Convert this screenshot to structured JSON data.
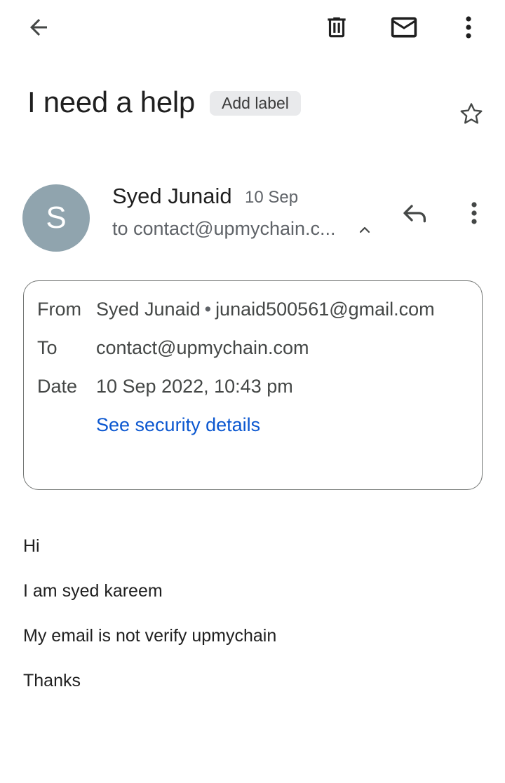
{
  "toolbar": {
    "back_icon": "arrow-back-icon",
    "delete_icon": "trash-icon",
    "mark_unread_icon": "mail-icon",
    "more_icon": "more-vert-icon"
  },
  "subject": {
    "title": "I need a help",
    "label_chip": "Add label",
    "star_icon": "star-outline-icon"
  },
  "message": {
    "avatar_initial": "S",
    "avatar_color": "#90a4ae",
    "sender_name": "Syed Junaid",
    "date": "10 Sep",
    "recipient_summary": "to contact@upmychain.c...",
    "collapse_icon": "chevron-up-icon",
    "reply_icon": "reply-icon",
    "more_icon": "more-vert-icon"
  },
  "details": {
    "from_label": "From",
    "from_name": "Syed Junaid",
    "from_separator": "•",
    "from_email": "junaid500561@gmail.com",
    "to_label": "To",
    "to_value": "contact@upmychain.com",
    "date_label": "Date",
    "date_value": "10 Sep 2022, 10:43 pm",
    "security_link": "See security details",
    "link_color": "#0b57d0"
  },
  "body": {
    "lines": [
      "Hi",
      "I am syed kareem",
      "My email is not verify upmychain",
      "Thanks"
    ]
  }
}
